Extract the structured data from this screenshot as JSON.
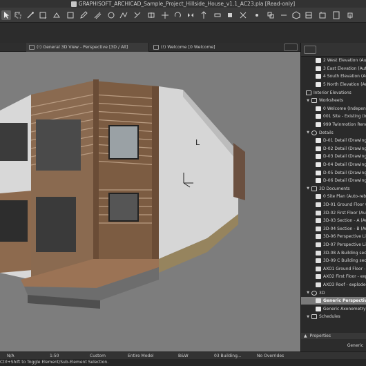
{
  "window": {
    "title": "GRAPHISOFT_ARCHICAD_Sample_Project_Hillside_House_v1.1_AC23.pla [Read-only]"
  },
  "tabs": [
    {
      "label": "(!) General 3D View - Perspective [3D / All]",
      "active": true
    },
    {
      "label": "(!) Welcome [0 Welcome]",
      "active": false
    }
  ],
  "viewport": {
    "axis_label": "L",
    "background": "#7d7d7d"
  },
  "navigator": {
    "items": [
      {
        "label": "2 West Elevation (Auto",
        "indent": 3,
        "icon": "elevation-icon",
        "selected": false
      },
      {
        "label": "3 East Elevation (Auto",
        "indent": 3,
        "icon": "elevation-icon",
        "selected": false
      },
      {
        "label": "4 South Elevation (Aut",
        "indent": 3,
        "icon": "elevation-icon",
        "selected": false
      },
      {
        "label": "5 North Elevation (Aut",
        "indent": 3,
        "icon": "elevation-icon",
        "selected": false
      },
      {
        "label": "Interior Elevations",
        "indent": 1,
        "icon": "folder-icon",
        "selected": false
      },
      {
        "label": "Worksheets",
        "indent": 1,
        "icon": "folder-icon",
        "expanded": true,
        "selected": false
      },
      {
        "label": "0 Welcome (Independ",
        "indent": 3,
        "icon": "worksheet-icon",
        "selected": false
      },
      {
        "label": "001 Site - Existing (Inc",
        "indent": 3,
        "icon": "worksheet-icon",
        "selected": false
      },
      {
        "label": "999 Twinmotion Rende",
        "indent": 3,
        "icon": "worksheet-icon",
        "selected": false
      },
      {
        "label": "Details",
        "indent": 1,
        "icon": "gear-icon",
        "expanded": true,
        "selected": false
      },
      {
        "label": "D-01 Detail (Drawing)",
        "indent": 3,
        "icon": "detail-icon",
        "selected": false
      },
      {
        "label": "D-02 Detail (Drawing)",
        "indent": 3,
        "icon": "detail-icon",
        "selected": false
      },
      {
        "label": "D-03 Detail (Drawing)",
        "indent": 3,
        "icon": "detail-icon",
        "selected": false
      },
      {
        "label": "D-04 Detail (Drawing)",
        "indent": 3,
        "icon": "detail-icon",
        "selected": false
      },
      {
        "label": "D-05 Detail (Drawing)",
        "indent": 3,
        "icon": "detail-icon",
        "selected": false
      },
      {
        "label": "D-06 Detail (Drawing)",
        "indent": 3,
        "icon": "detail-icon",
        "selected": false
      },
      {
        "label": "3D Documents",
        "indent": 1,
        "icon": "folder-icon",
        "expanded": true,
        "selected": false
      },
      {
        "label": "0 Site Plan (Auto-rebu",
        "indent": 3,
        "icon": "document-3d-icon",
        "selected": false
      },
      {
        "label": "3D-01 Ground Floor (A",
        "indent": 3,
        "icon": "document-3d-icon",
        "selected": false
      },
      {
        "label": "3D-02 First Floor (Aut",
        "indent": 3,
        "icon": "document-3d-icon",
        "selected": false
      },
      {
        "label": "3D-03 Section - A (Au",
        "indent": 3,
        "icon": "document-3d-icon",
        "selected": false
      },
      {
        "label": "3D-04 Section - B (Au",
        "indent": 3,
        "icon": "document-3d-icon",
        "selected": false
      },
      {
        "label": "3D-06 Perspective Lin",
        "indent": 3,
        "icon": "document-3d-icon",
        "selected": false
      },
      {
        "label": "3D-07 Perspective Lin",
        "indent": 3,
        "icon": "document-3d-icon",
        "selected": false
      },
      {
        "label": "3D-08 A Building sect",
        "indent": 3,
        "icon": "document-3d-icon",
        "selected": false
      },
      {
        "label": "3D-09 C Building sect",
        "indent": 3,
        "icon": "document-3d-icon",
        "selected": false
      },
      {
        "label": "AXO1 Ground Floor - e",
        "indent": 3,
        "icon": "document-3d-icon",
        "selected": false
      },
      {
        "label": "AXO2 First Floor - exp",
        "indent": 3,
        "icon": "document-3d-icon",
        "selected": false
      },
      {
        "label": "AXO3 Roof - exploded",
        "indent": 3,
        "icon": "document-3d-icon",
        "selected": false
      },
      {
        "label": "3D",
        "indent": 1,
        "icon": "cube-icon",
        "expanded": true,
        "selected": false
      },
      {
        "label": "Generic Perspective",
        "indent": 3,
        "icon": "camera-icon",
        "selected": true
      },
      {
        "label": "Generic Axonometry",
        "indent": 3,
        "icon": "axonometry-icon",
        "selected": false
      },
      {
        "label": "Schedules",
        "indent": 1,
        "icon": "folder-icon",
        "expanded": true,
        "selected": false
      }
    ]
  },
  "properties": {
    "header": "Properties",
    "value": "Generic"
  },
  "quick_options": {
    "zoom": "N/A",
    "scale": "1:50",
    "layer_combo": "Custom",
    "model_view": "Entire Model",
    "pen_set": "B&W",
    "mvo": "03 Building...",
    "renovation": "No Overrides"
  },
  "status": {
    "text": "Ctrl+Shift to Toggle Element/Sub-Element Selection."
  }
}
